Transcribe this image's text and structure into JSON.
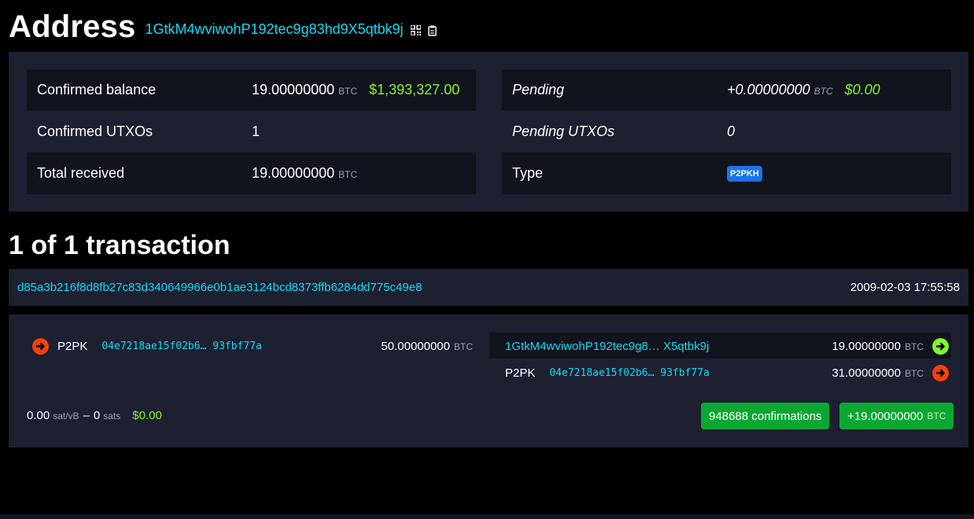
{
  "header": {
    "title": "Address",
    "address": "1GtkM4wviwohP192tec9g83hd9X5qtbk9j",
    "qr_icon": "qr-code-icon",
    "copy_icon": "copy-icon"
  },
  "stats": {
    "confirmed_balance": {
      "label": "Confirmed balance",
      "value": "19.00000000",
      "unit": "BTC",
      "usd": "$1,393,327.00"
    },
    "confirmed_utxos": {
      "label": "Confirmed UTXOs",
      "value": "1"
    },
    "total_received": {
      "label": "Total received",
      "value": "19.00000000",
      "unit": "BTC"
    },
    "pending": {
      "label": "Pending",
      "value": "+0.00000000",
      "unit": "BTC",
      "usd": "$0.00"
    },
    "pending_utxos": {
      "label": "Pending UTXOs",
      "value": "0"
    },
    "type": {
      "label": "Type",
      "value": "P2PKH"
    }
  },
  "transactions": {
    "heading": "1 of 1 transaction",
    "tx": {
      "hash": "d85a3b216f8d8fb27c83d340649966e0b1ae3124bcd8373ffb6284dd775c49e8",
      "time": "2009-02-03 17:55:58",
      "inputs": [
        {
          "type": "P2PK",
          "pubkey": "04e7218ae15f02b6… 93fbf77a",
          "amount": "50.00000000",
          "unit": "BTC"
        }
      ],
      "outputs": [
        {
          "address": "1GtkM4wviwohP192tec9g8… X5qtbk9j",
          "amount": "19.00000000",
          "unit": "BTC"
        },
        {
          "type": "P2PK",
          "pubkey": "04e7218ae15f02b6… 93fbf77a",
          "amount": "31.00000000",
          "unit": "BTC"
        }
      ],
      "fee": {
        "rate": "0.00",
        "rate_unit": "sat/vB",
        "sep": "–",
        "sats": "0",
        "sats_unit": "sats",
        "usd": "$0.00"
      },
      "confirmations": "948688 confirmations",
      "net": {
        "value": "+19.00000000",
        "unit": "BTC"
      }
    }
  },
  "colors": {
    "accent_cyan": "#1bd8f4",
    "usd_green": "#83f52c",
    "confirm_green": "#0ca732",
    "badge_blue": "#1a73e8",
    "arrow_red": "#f5410a"
  }
}
